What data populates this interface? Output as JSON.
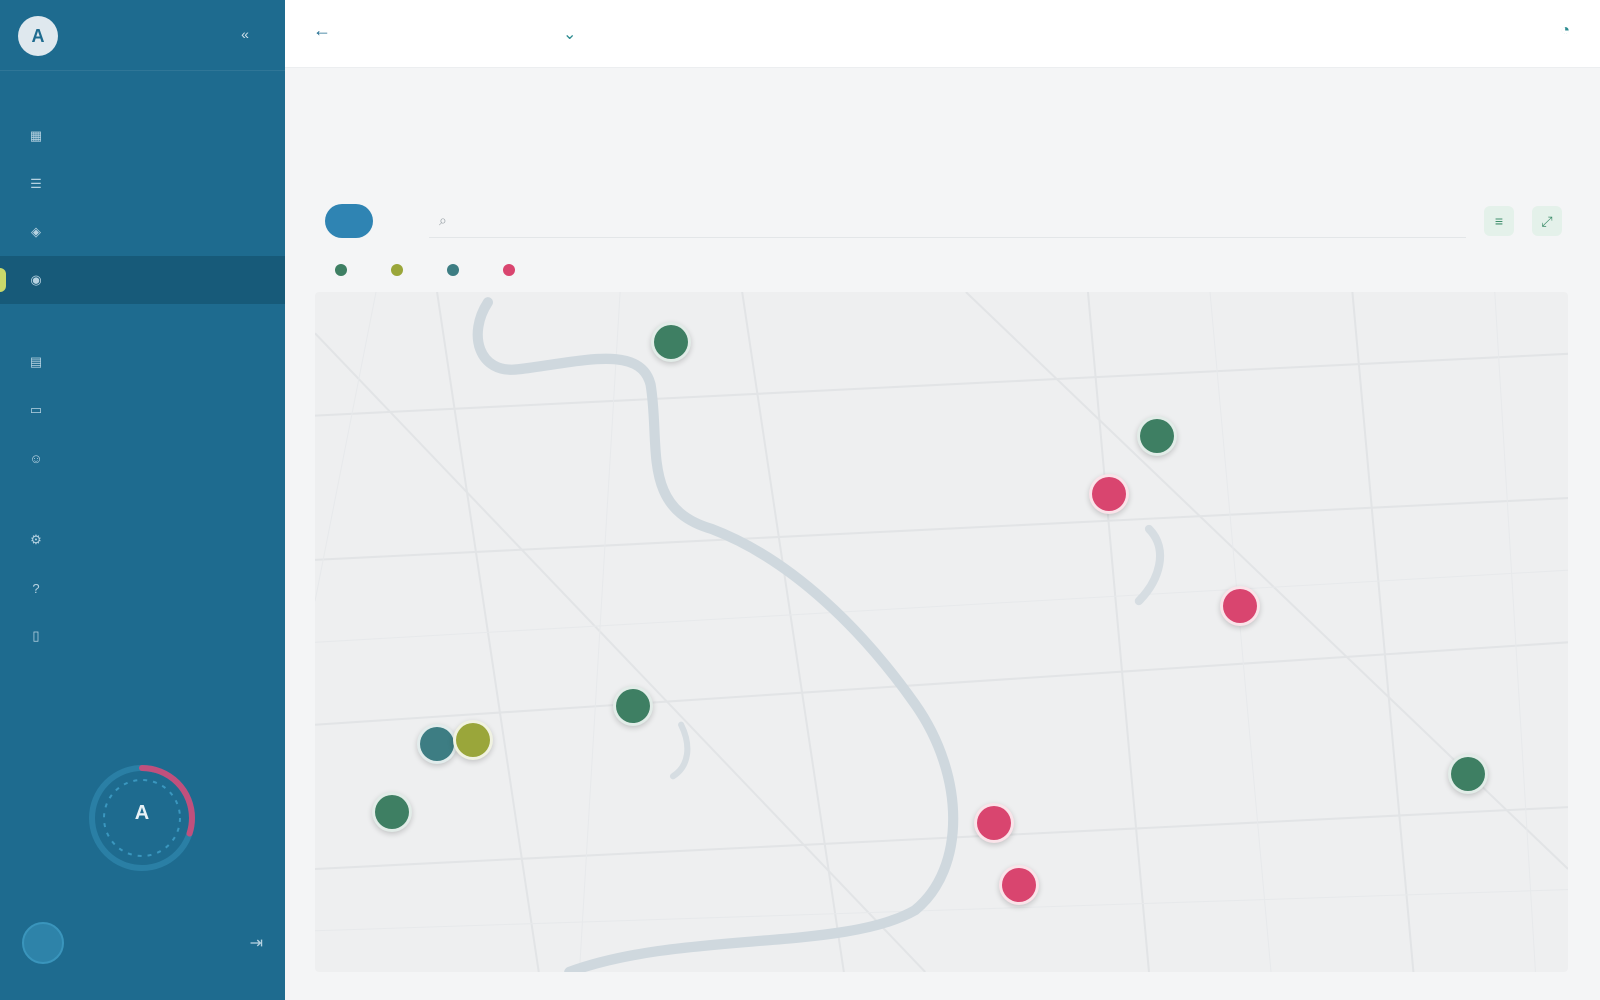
{
  "app": {
    "brand_initial": "A",
    "brand_name": "",
    "title": "",
    "subtitle": "",
    "date": "",
    "collapse_icon": "double-chevron-left-icon"
  },
  "sidebar": {
    "sections": [
      {
        "label": ""
      },
      {
        "label": ""
      },
      {
        "label": ""
      }
    ],
    "items": [
      {
        "label": "",
        "icon": "dashboard-icon"
      },
      {
        "label": "",
        "icon": "list-icon"
      },
      {
        "label": "",
        "icon": "layers-icon"
      },
      {
        "label": "",
        "icon": "map-icon",
        "active": true
      },
      {
        "label": "",
        "icon": "chart-icon"
      },
      {
        "label": "",
        "icon": "folder-icon"
      },
      {
        "label": "",
        "icon": "users-icon"
      },
      {
        "label": "",
        "icon": "gear-icon"
      },
      {
        "label": "",
        "icon": "help-icon"
      },
      {
        "label": "",
        "icon": "document-icon"
      }
    ],
    "gauge": {
      "label": "A",
      "value_fraction": 0.3
    },
    "user": {
      "initials": "",
      "name": "",
      "role": ""
    }
  },
  "content": {
    "breadcrumb": "",
    "page_title": "",
    "toolbar": {
      "primary_label": "",
      "secondary_label": "",
      "search_placeholder": ""
    },
    "legend": [
      {
        "label": "",
        "color": "#3e7f63"
      },
      {
        "label": "",
        "color": "#9aa63a"
      },
      {
        "label": "",
        "color": "#3d7d83"
      },
      {
        "label": "",
        "color": "#d9456f"
      }
    ],
    "map": {
      "labels": [
        "",
        "",
        "",
        "",
        ""
      ],
      "markers": [
        {
          "status": "green"
        },
        {
          "status": "green"
        },
        {
          "status": "red"
        },
        {
          "status": "red"
        },
        {
          "status": "green"
        },
        {
          "status": "teal"
        },
        {
          "status": "lime"
        },
        {
          "status": "green"
        },
        {
          "status": "red"
        },
        {
          "status": "red"
        },
        {
          "status": "green"
        }
      ],
      "scale": ""
    }
  },
  "colors": {
    "sidebar": "#1e6b8f",
    "accent": "#2f84b3",
    "active_indicator": "#c9d96b",
    "marker_green": "#3e7f63",
    "marker_red": "#d9456f",
    "marker_lime": "#9aa63a",
    "marker_teal": "#3d7d83"
  }
}
